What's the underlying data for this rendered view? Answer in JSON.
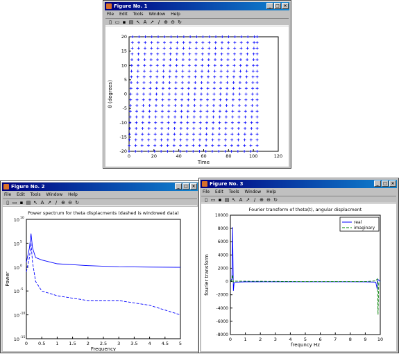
{
  "menus_a": [
    "File",
    "Edit",
    "Tools",
    "Window",
    "Help"
  ],
  "figures": [
    {
      "title": "Figure No. 1",
      "xlabel": "Time",
      "ylabel": "θ (degrees)",
      "xticks": [
        "0",
        "20",
        "40",
        "60",
        "80",
        "100",
        "120"
      ],
      "yticks": [
        "20",
        "15",
        "10",
        "5",
        "0",
        "-5",
        "-10",
        "-15",
        "-20"
      ]
    },
    {
      "title": "Figure No. 2",
      "plot_title": "Power spectrum for theta displacments (dashed is windowed data)",
      "xlabel": "Frequency",
      "ylabel": "Power",
      "xticks": [
        "0",
        "0.5",
        "1",
        "1.5",
        "2",
        "2.5",
        "3",
        "3.5",
        "4",
        "4.5",
        "5"
      ],
      "yticks": [
        "10",
        "10",
        "10",
        "10",
        "10"
      ],
      "yexp": [
        "10",
        "5",
        "0",
        "-5",
        "-10",
        "-15"
      ]
    },
    {
      "title": "Figure No. 3",
      "plot_title": "Fourier transform of theta(t), angular displacment",
      "xlabel": "frequncy Hz",
      "ylabel": "fourier transform",
      "xticks": [
        "0",
        "1",
        "2",
        "3",
        "4",
        "5",
        "6",
        "7",
        "8",
        "9",
        "10"
      ],
      "yticks": [
        "10000",
        "8000",
        "6000",
        "4000",
        "2000",
        "0",
        "-2000",
        "-4000",
        "-6000",
        "-8000"
      ],
      "legend": [
        "real",
        "imaginary"
      ]
    }
  ],
  "colors": {
    "blue": "#0000ff",
    "green": "#008000"
  },
  "chart_data": [
    {
      "type": "scatter",
      "marker": "+",
      "xlabel": "Time",
      "ylabel": "θ (degrees)",
      "xlim": [
        0,
        120
      ],
      "ylim": [
        -20,
        20
      ],
      "x_range_of_data": [
        0,
        103
      ],
      "vertical_sweeps_approx": 21,
      "y_spread": [
        -20,
        20
      ]
    },
    {
      "type": "line",
      "title": "Power spectrum for theta displacments (dashed is windowed data)",
      "xlabel": "Frequency",
      "ylabel": "Power",
      "xlim": [
        0,
        5
      ],
      "ylim": [
        1e-15,
        10000000000.0
      ],
      "yscale": "log",
      "series": [
        {
          "style": "solid",
          "x": [
            0,
            0.1,
            0.15,
            0.2,
            0.3,
            0.5,
            1,
            2,
            3,
            4,
            5
          ],
          "y": [
            10,
            10000.0,
            10000000.0,
            10000.0,
            100.0,
            30.0,
            5,
            2,
            1.2,
            1,
            0.9
          ]
        },
        {
          "style": "dashed",
          "x": [
            0,
            0.1,
            0.15,
            0.2,
            0.3,
            0.5,
            1,
            2,
            3,
            4,
            5
          ],
          "y": [
            0.1,
            100.0,
            100000.0,
            10.0,
            0.001,
            1e-05,
            1e-06,
            1e-07,
            1e-07,
            1e-08,
            1e-10
          ]
        }
      ]
    },
    {
      "type": "line",
      "title": "Fourier transform of theta(t), angular displacment",
      "xlabel": "frequncy Hz",
      "ylabel": "fourier transform",
      "xlim": [
        0,
        10
      ],
      "ylim": [
        -8000,
        10000
      ],
      "series": [
        {
          "name": "real",
          "x": [
            0,
            0.1,
            0.15,
            0.2,
            0.25,
            0.35,
            1,
            5,
            9,
            9.7,
            9.8,
            9.85,
            9.9,
            10
          ],
          "y": [
            0,
            400,
            8200,
            -1400,
            -200,
            -100,
            -50,
            -40,
            -50,
            -100,
            -1200,
            300,
            200,
            0
          ]
        },
        {
          "name": "imaginary",
          "x": [
            0,
            0.1,
            0.15,
            0.2,
            0.3,
            1,
            5,
            9,
            9.7,
            9.8,
            9.85,
            9.9,
            10
          ],
          "y": [
            0,
            200,
            1000,
            -100,
            50,
            50,
            0,
            0,
            100,
            400,
            -5000,
            -200,
            0
          ]
        }
      ]
    }
  ]
}
